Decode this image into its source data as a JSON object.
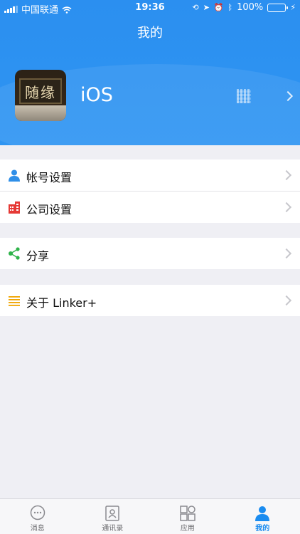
{
  "status_bar": {
    "carrier": "中国联通",
    "time": "19:36",
    "battery_percent": "100%"
  },
  "header": {
    "title": "我的",
    "username": "iOS",
    "avatar_icon": "plaque-photo",
    "qr_icon": "qrcode-icon"
  },
  "menu": {
    "account_settings": "帐号设置",
    "company_settings": "公司设置",
    "share": "分享",
    "about": "关于 Linker+"
  },
  "tabs": [
    {
      "label": "消息",
      "icon": "message-icon"
    },
    {
      "label": "通讯录",
      "icon": "contacts-icon"
    },
    {
      "label": "应用",
      "icon": "apps-icon"
    },
    {
      "label": "我的",
      "icon": "me-icon"
    }
  ],
  "colors": {
    "brand_blue": "#2f95f2",
    "active_tab": "#1a8cf0",
    "company_icon": "#e53935",
    "share_icon": "#2fb34a",
    "about_icon": "#f0a500"
  }
}
